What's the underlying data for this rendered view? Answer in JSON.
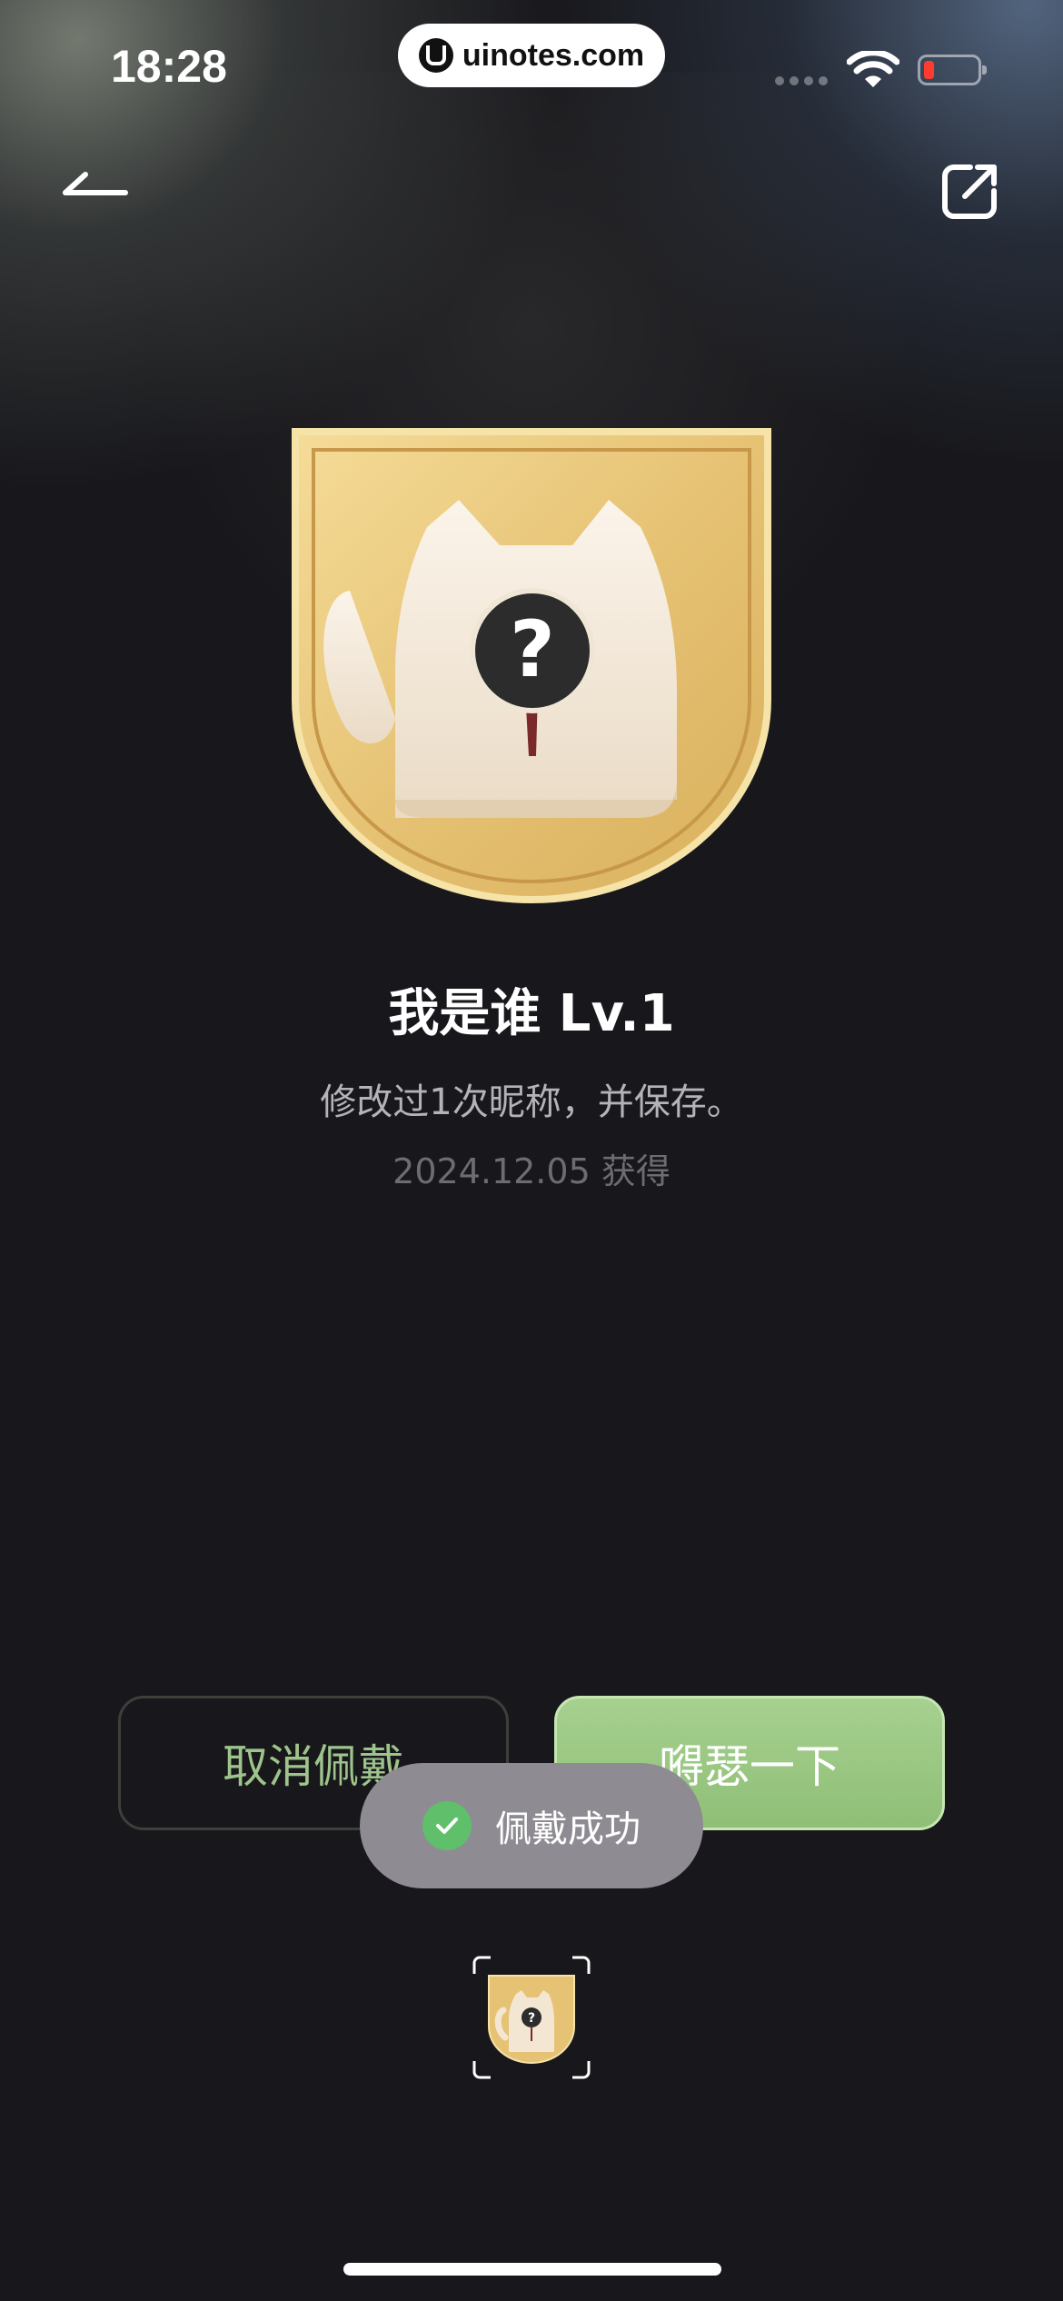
{
  "status_bar": {
    "time": "18:28",
    "url": "uinotes.com",
    "battery_level_fraction": 0.2
  },
  "nav": {
    "back_icon": "back-arrow-icon",
    "share_icon": "share-icon"
  },
  "badge": {
    "title": "我是谁 Lv.1",
    "description": "修改过1次昵称，并保存。",
    "obtained_date": "2024.12.05 获得",
    "emblem_glyph": "?",
    "colors": {
      "gold": "#e8c878",
      "cat": "#f3e6d2"
    }
  },
  "actions": {
    "cancel_label": "取消佩戴",
    "show_off_label": "嘚瑟一下",
    "accent_green": "#9ec48b"
  },
  "toast": {
    "text": "佩戴成功",
    "icon": "check-circle-icon"
  }
}
